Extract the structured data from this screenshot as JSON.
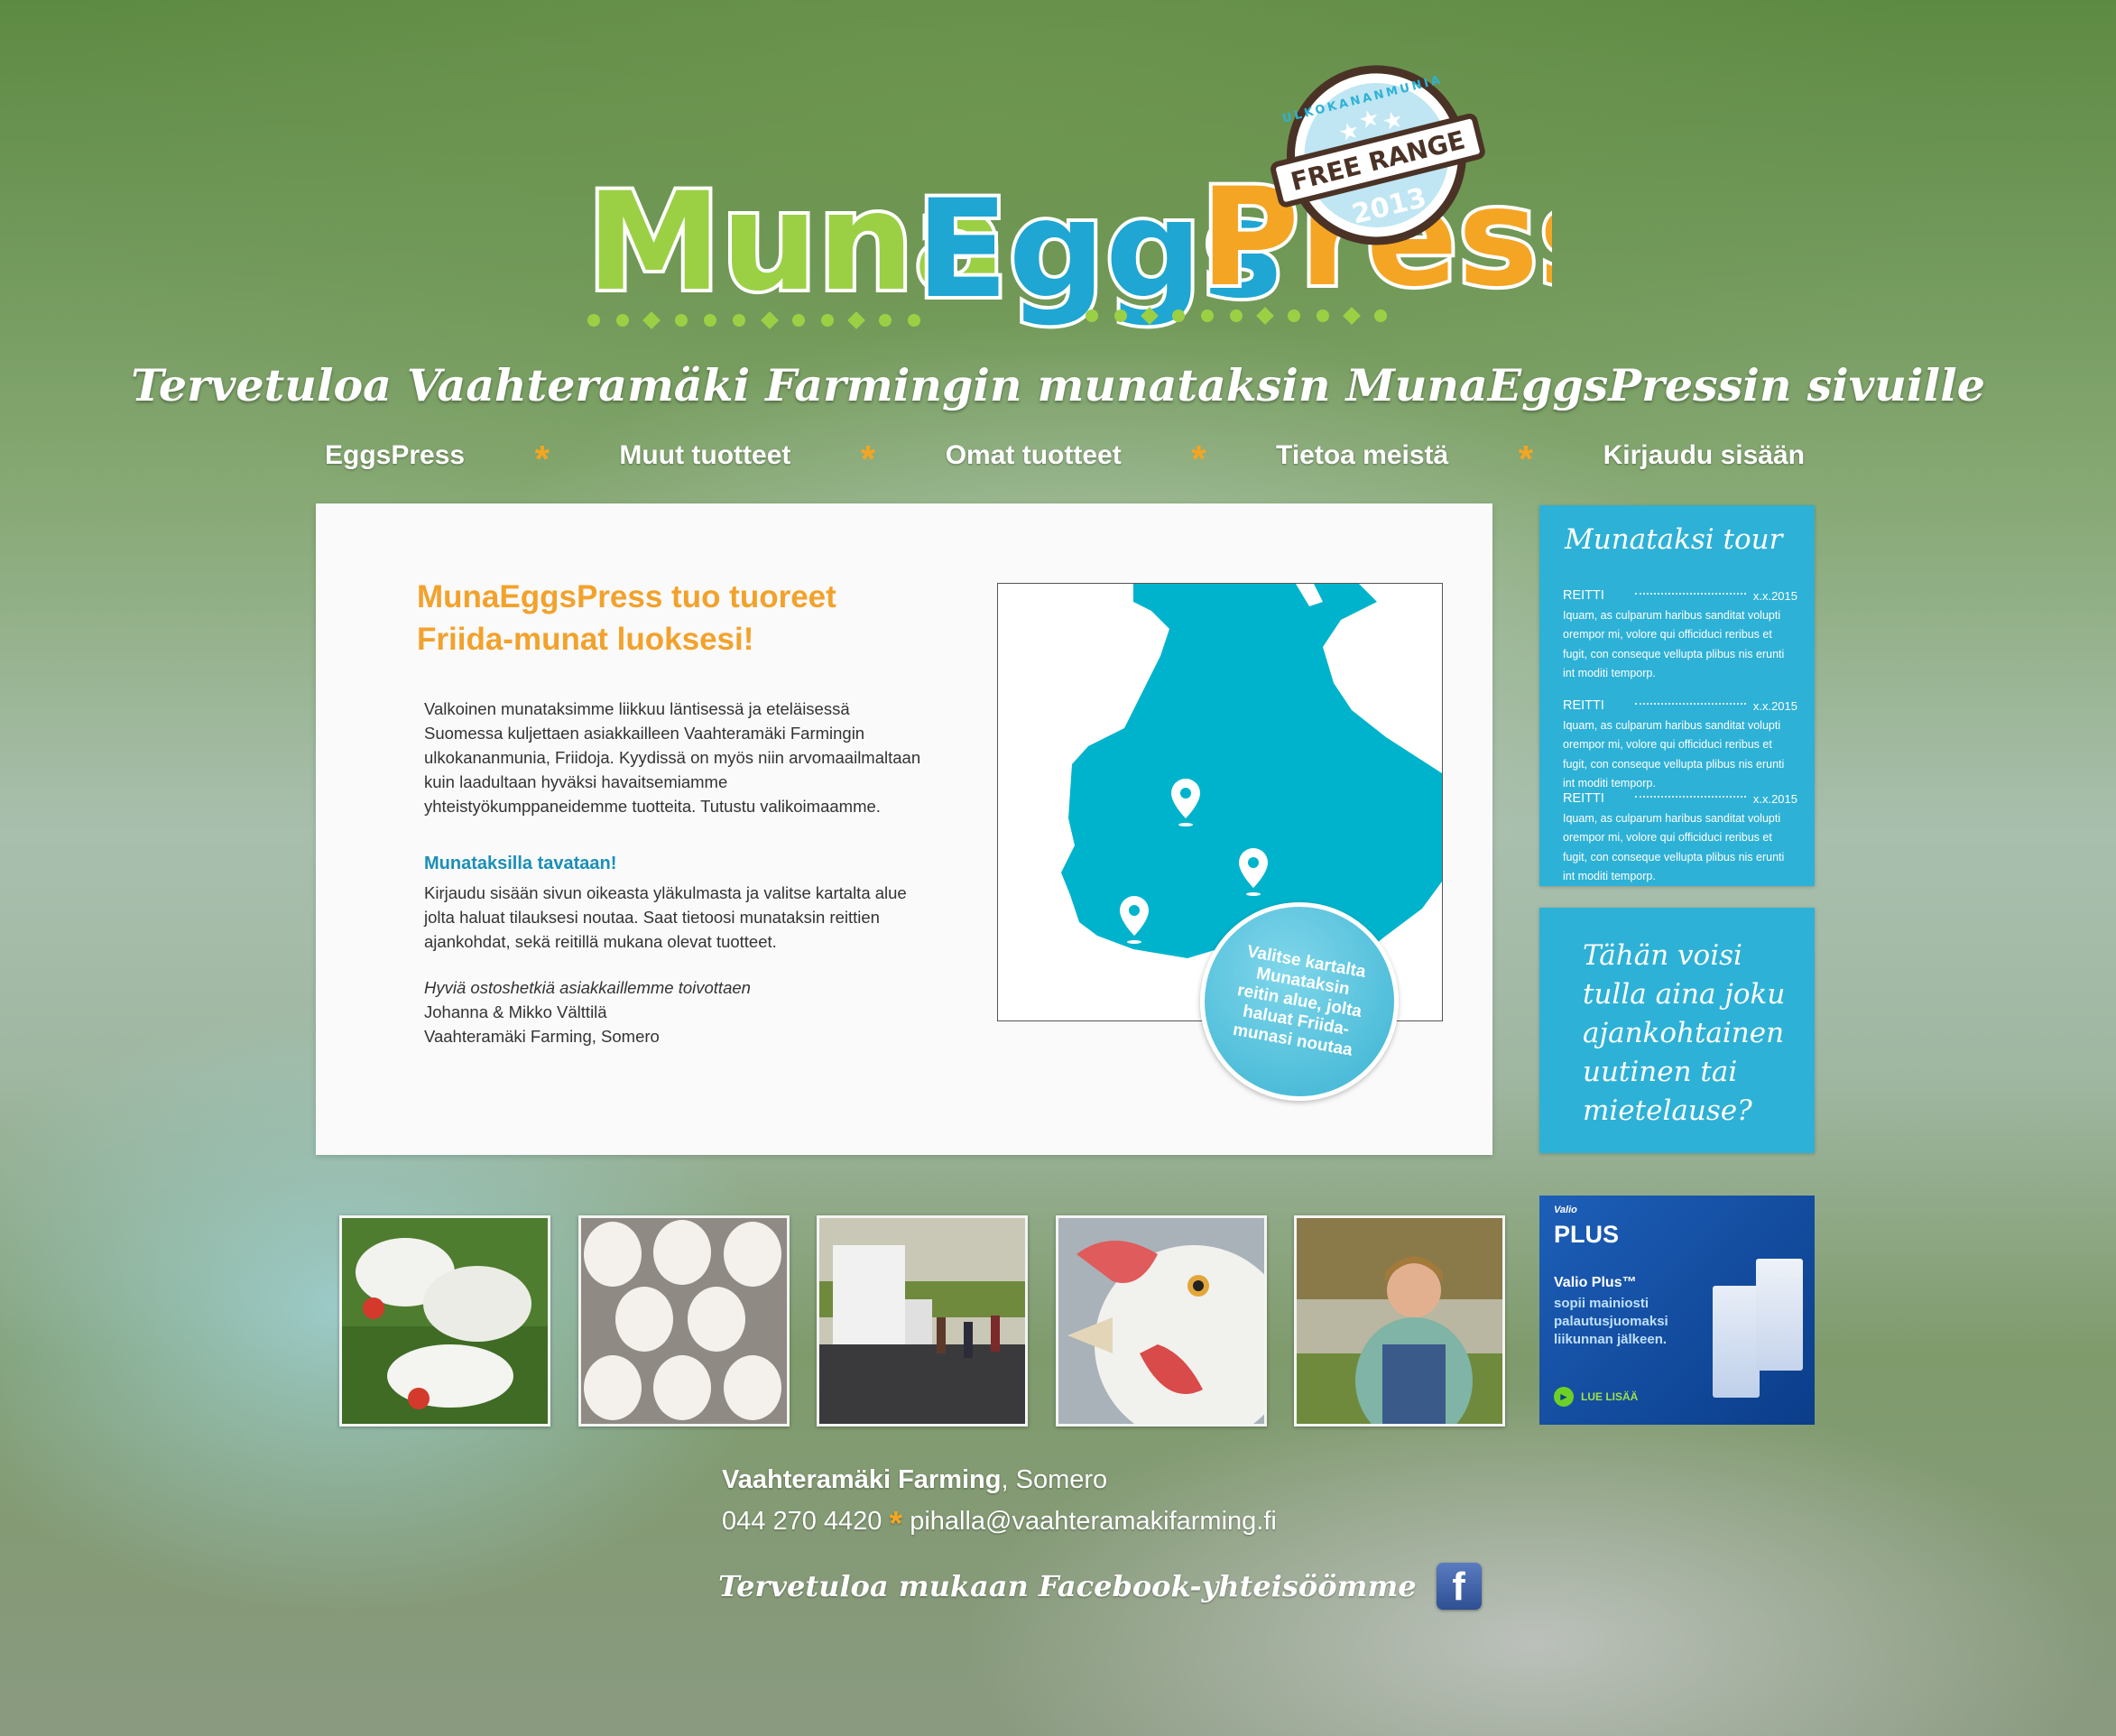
{
  "logo": {
    "part1": "Muna",
    "part2": "Eggs",
    "part3": "Press",
    "badge_arc": "ULKOKANANMUNIA",
    "badge_label": "FREE RANGE",
    "badge_year": "2013"
  },
  "welcome": "Tervetuloa Vaahteramäki Farmingin munataksin MunaEggsPressin sivuille",
  "nav": {
    "items": [
      "EggsPress",
      "Muut tuotteet",
      "Omat tuotteet",
      "Tietoa meistä",
      "Kirjaudu sisään"
    ],
    "separator": "*"
  },
  "main": {
    "headline": "MunaEggsPress tuo tuoreet Friida-munat luoksesi!",
    "paragraph1": "Valkoinen munataksimme liikkuu läntisessä ja eteläisessä Suomessa kuljettaen asiakkailleen Vaahteramäki Farmingin ulkokananmunia, Friidoja. Kyydissä on myös niin arvomaailmaltaan kuin laadultaan hyväksi havaitsemiamme yhteistyökumppaneidemme tuotteita. Tutustu valikoimaamme.",
    "subheading": "Munataksilla tavataan!",
    "paragraph2": "Kirjaudu sisään sivun oikeasta yläkulmasta ja valitse kartalta alue jolta haluat tilauksesi noutaa. Saat tietoosi munataksin reittien ajankohdat, sekä reitillä mukana olevat tuotteet.",
    "greeting": "Hyviä ostoshetkiä asiakkaillemme toivottaen",
    "signature1": "Johanna & Mikko Välttilä",
    "signature2": "Vaahteramäki Farming, Somero",
    "map_badge": "Valitse kartalta Munataksin reitin alue, jolta haluat Friida-munasi noutaa"
  },
  "tour": {
    "title": "Munataksi tour",
    "routes": [
      {
        "label": "REITTI",
        "date": "x.x.2015",
        "text": "Iquam, as culparum haribus sanditat volupti orempor mi, volore qui officiduci reribus et fugit, con conseque vellupta plibus nis erunti int moditi temporp."
      },
      {
        "label": "REITTI",
        "date": "x.x.2015",
        "text": "Iquam, as culparum haribus sanditat volupti orempor mi, volore qui officiduci reribus et fugit, con conseque vellupta plibus nis erunti int moditi temporp."
      },
      {
        "label": "REITTI",
        "date": "x.x.2015",
        "text": "Iquam, as culparum haribus sanditat volupti orempor mi, volore qui officiduci reribus et fugit, con conseque vellupta plibus nis erunti int moditi temporp."
      }
    ]
  },
  "quote": "Tähän voisi tulla aina joku ajankohtainen uutinen tai mietelause?",
  "ad": {
    "brand": "Valio",
    "product": "PLUS",
    "title": "Valio Plus™",
    "text": "sopii mainiosti palautusjuomaksi liikunnan jälkeen.",
    "cta": "LUE LISÄÄ"
  },
  "footer": {
    "company": "Vaahteramäki Farming",
    "location": ", Somero",
    "phone": "044 270 4420",
    "separator": "*",
    "email": "pihalla@vaahteramakifarming.fi",
    "facebook": "Tervetuloa mukaan Facebook-yhteisöömme",
    "fb_glyph": "f"
  },
  "colors": {
    "orange": "#f2a22c",
    "teal": "#2eb1d6",
    "green": "#8cc63f",
    "blue": "#1a8fb6"
  }
}
